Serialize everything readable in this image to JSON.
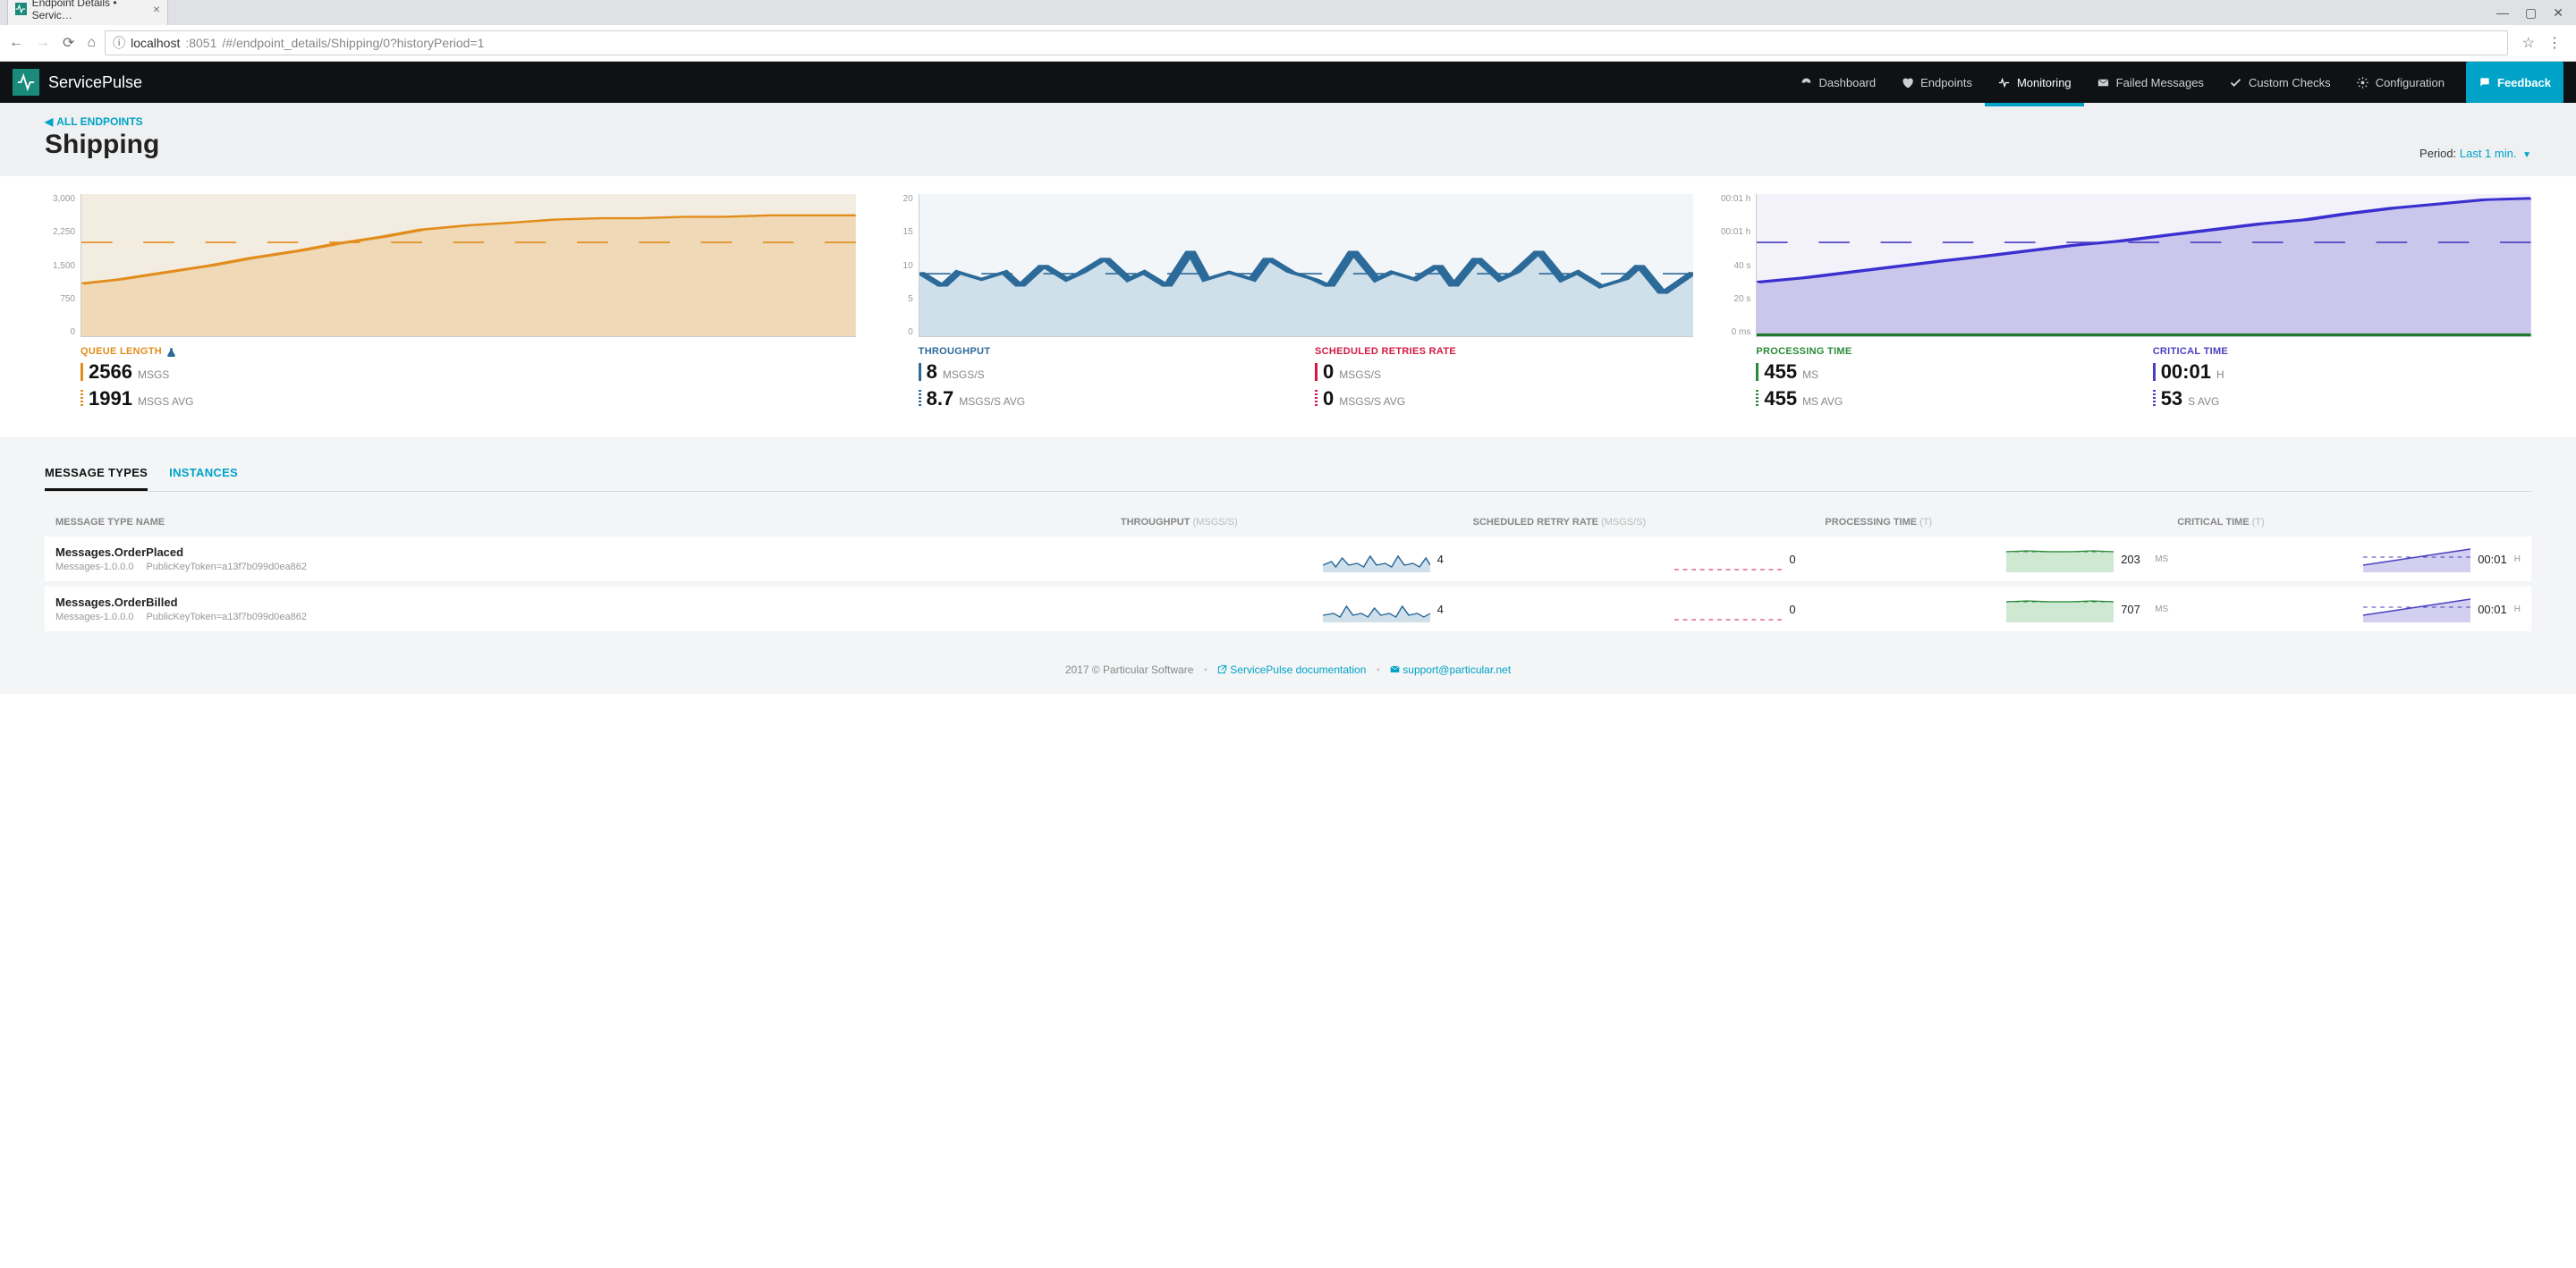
{
  "browser": {
    "tab_title": "Endpoint Details • Servic…",
    "url_host": "localhost",
    "url_port": ":8051",
    "url_path": "/#/endpoint_details/Shipping/0?historyPeriod=1"
  },
  "header": {
    "brand": "ServicePulse",
    "nav": {
      "dashboard": "Dashboard",
      "endpoints": "Endpoints",
      "monitoring": "Monitoring",
      "failed": "Failed Messages",
      "custom": "Custom Checks",
      "config": "Configuration",
      "feedback": "Feedback"
    }
  },
  "page": {
    "back": "ALL ENDPOINTS",
    "title": "Shipping",
    "period_label": "Period:",
    "period_value": "Last 1 min."
  },
  "metrics": {
    "queue": {
      "label": "QUEUE LENGTH",
      "value": "2566",
      "unit": "MSGS",
      "avg": "1991",
      "avg_unit": "MSGS AVG"
    },
    "throughput": {
      "label": "THROUGHPUT",
      "value": "8",
      "unit": "MSGS/S",
      "avg": "8.7",
      "avg_unit": "MSGS/S AVG"
    },
    "retries": {
      "label": "SCHEDULED RETRIES RATE",
      "value": "0",
      "unit": "MSGS/S",
      "avg": "0",
      "avg_unit": "MSGS/S AVG"
    },
    "processing": {
      "label": "PROCESSING TIME",
      "value": "455",
      "unit": "MS",
      "avg": "455",
      "avg_unit": "MS AVG"
    },
    "critical": {
      "label": "CRITICAL TIME",
      "value": "00:01",
      "unit": "H",
      "avg": "53",
      "avg_unit": "S AVG"
    }
  },
  "chart_data": [
    {
      "type": "area",
      "title": "Queue length",
      "ylabel": "",
      "ylim": [
        0,
        3000
      ],
      "ticks": [
        "3,000",
        "2,250",
        "1,500",
        "750",
        "0"
      ],
      "avg_line": 1991,
      "values": [
        1100,
        1200,
        1350,
        1500,
        1650,
        1800,
        1950,
        2100,
        2250,
        2350,
        2420,
        2460,
        2480,
        2500,
        2520,
        2540,
        2550,
        2560,
        2566
      ],
      "color": "#e28c1b"
    },
    {
      "type": "area",
      "title": "Throughput / Scheduled retries",
      "ylabel": "",
      "ylim": [
        0,
        20
      ],
      "ticks": [
        "20",
        "15",
        "10",
        "5",
        "0"
      ],
      "avg_line": 8.7,
      "series": [
        {
          "name": "Throughput",
          "color": "#2c6a9a",
          "values": [
            9,
            7,
            9,
            8,
            9,
            7,
            10,
            8,
            9,
            11,
            8,
            9,
            7,
            12,
            8,
            9,
            8,
            11,
            9,
            8,
            7,
            12,
            8,
            9,
            8,
            10,
            7,
            11,
            8,
            9,
            12,
            8,
            9,
            7,
            8,
            10,
            6,
            9
          ]
        },
        {
          "name": "Scheduled retries",
          "color": "#d11a44",
          "values": [
            0,
            0,
            0,
            0,
            0,
            0,
            0,
            0,
            0,
            0,
            0,
            0,
            0,
            0,
            0,
            0,
            0,
            0,
            0,
            0,
            0,
            0,
            0,
            0,
            0,
            0,
            0,
            0,
            0,
            0,
            0,
            0,
            0,
            0,
            0,
            0,
            0,
            0
          ]
        }
      ]
    },
    {
      "type": "area",
      "title": "Processing / Critical time",
      "ylabel": "",
      "ticks": [
        "00:01 h",
        "00:01 h",
        "40 s",
        "20 s",
        "0 ms"
      ],
      "ylim": [
        0,
        80
      ],
      "avg_line": 53,
      "series": [
        {
          "name": "Critical time",
          "color": "#4a3fbf",
          "values": [
            30,
            33,
            36,
            39,
            42,
            45,
            48,
            51,
            54,
            57,
            60,
            63,
            66,
            69,
            72,
            75,
            77,
            78
          ]
        },
        {
          "name": "Processing time",
          "color": "#2a8a3a",
          "values": [
            0.5,
            0.5,
            0.5,
            0.5,
            0.5,
            0.5,
            0.5,
            0.5,
            0.5,
            0.5,
            0.5,
            0.5,
            0.5,
            0.5,
            0.5,
            0.5,
            0.5,
            0.5
          ]
        }
      ]
    }
  ],
  "tabs": {
    "message_types": "MESSAGE TYPES",
    "instances": "INSTANCES"
  },
  "table": {
    "headers": {
      "name": "MESSAGE TYPE NAME",
      "throughput": "THROUGHPUT",
      "throughput_sub": "(MSGS/S)",
      "retry": "SCHEDULED RETRY RATE",
      "retry_sub": "(MSGS/S)",
      "processing": "PROCESSING TIME",
      "processing_sub": "(T)",
      "critical": "CRITICAL TIME",
      "critical_sub": "(T)"
    },
    "rows": [
      {
        "name": "Messages.OrderPlaced",
        "assembly": "Messages-1.0.0.0",
        "token": "PublicKeyToken=a13f7b099d0ea862",
        "throughput": "4",
        "retry": "0",
        "processing": "203",
        "processing_unit": "MS",
        "critical": "00:01",
        "critical_unit": "H"
      },
      {
        "name": "Messages.OrderBilled",
        "assembly": "Messages-1.0.0.0",
        "token": "PublicKeyToken=a13f7b099d0ea862",
        "throughput": "4",
        "retry": "0",
        "processing": "707",
        "processing_unit": "MS",
        "critical": "00:01",
        "critical_unit": "H"
      }
    ]
  },
  "footer": {
    "copyright": "2017 © Particular Software",
    "docs": "ServicePulse documentation",
    "support": "support@particular.net"
  }
}
